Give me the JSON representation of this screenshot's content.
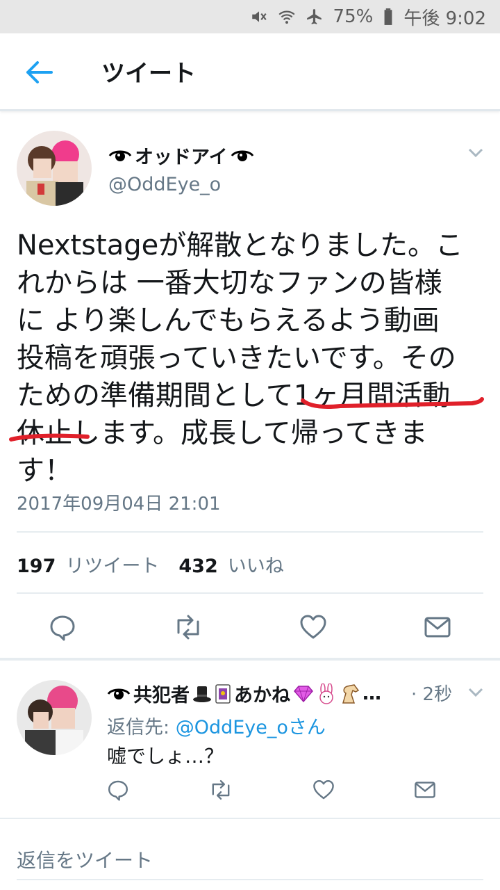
{
  "status_bar": {
    "battery": "75%",
    "time": "午後 9:02"
  },
  "header": {
    "title": "ツイート"
  },
  "tweet": {
    "display_name": "オッドアイ",
    "handle": "@OddEye_o",
    "text_lines": [
      "Nextstageが解散となりました。こ",
      "れからは 一番大切なファンの皆様",
      "に より楽しんでもらえるよう動画",
      "投稿を頑張っていきたいです。その",
      "ための準備期間として1ヶ月間活動",
      "休止します。成長して帰ってきま",
      "す！"
    ],
    "timestamp": "2017年09月04日 21:01",
    "retweet_count": "197",
    "retweet_label": "リツイート",
    "like_count": "432",
    "like_label": "いいね"
  },
  "reply": {
    "display_name": "共犯者",
    "display_name_2": "あかね",
    "ellipsis": "…",
    "time": "· 2秒",
    "reply_to_prefix": "返信先: ",
    "reply_to_link": "@OddEye_oさん",
    "text": "嘘でしょ…？"
  },
  "compose": {
    "placeholder": "返信をツイート"
  },
  "colors": {
    "accent": "#1da1f2",
    "secondary_text": "#657786",
    "divider": "#e6ecf0",
    "annotation_red": "#e0202a"
  },
  "icons": [
    "mute-icon",
    "wifi-icon",
    "airplane-icon",
    "battery-icon",
    "back-arrow-icon",
    "chevron-down-icon",
    "reply-icon",
    "retweet-icon",
    "like-icon",
    "dm-icon",
    "eye-icon",
    "top-hat-icon",
    "joker-card-icon",
    "gem-icon",
    "rabbit-icon",
    "horse-icon"
  ]
}
